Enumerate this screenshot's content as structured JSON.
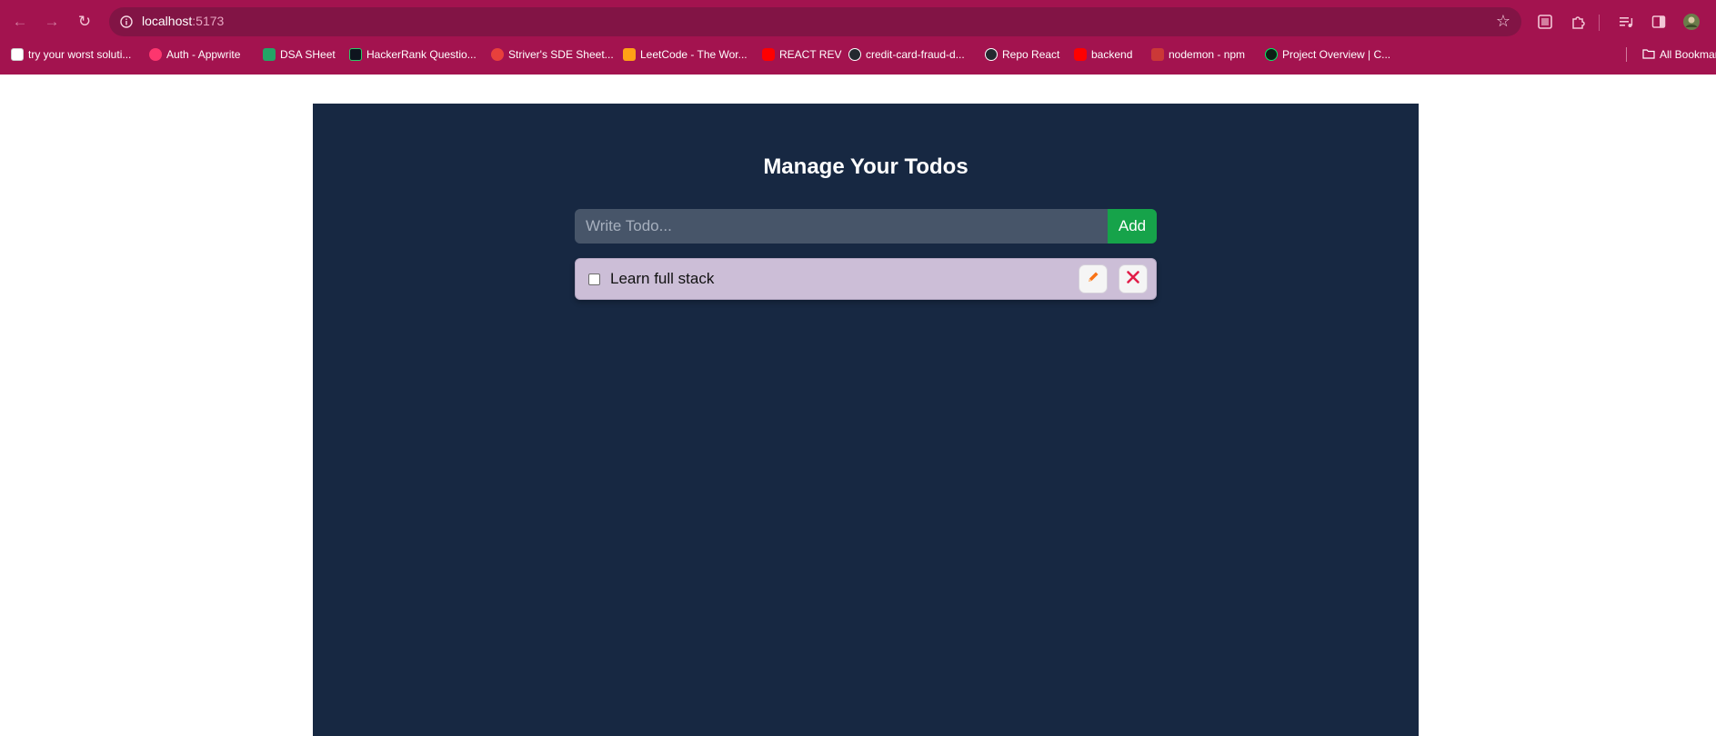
{
  "browser": {
    "url_host": "localhost",
    "url_port": ":5173",
    "bookmarks": [
      {
        "label": "try your worst soluti...",
        "color": "#ffffff"
      },
      {
        "label": "Auth - Appwrite",
        "color": "#fd366e"
      },
      {
        "label": "DSA SHeet",
        "color": "#23a566"
      },
      {
        "label": "HackerRank Questio...",
        "color": "#0e141e"
      },
      {
        "label": "Striver's SDE Sheet...",
        "color": "#e8403c"
      },
      {
        "label": "LeetCode - The Wor...",
        "color": "#ffa116"
      },
      {
        "label": "REACT REV",
        "color": "#ff0000"
      },
      {
        "label": "credit-card-fraud-d...",
        "color": "#24292f"
      },
      {
        "label": "Repo React",
        "color": "#24292f"
      },
      {
        "label": "backend",
        "color": "#ff0000"
      },
      {
        "label": "nodemon - npm",
        "color": "#cb3837"
      },
      {
        "label": "Project Overview | C...",
        "color": "#0b1f14"
      }
    ],
    "all_bookmarks_label": "All Bookmarks"
  },
  "app": {
    "title": "Manage Your Todos",
    "input_placeholder": "Write Todo...",
    "add_label": "Add",
    "todos": [
      {
        "text": "Learn full stack",
        "completed": false
      }
    ]
  },
  "colors": {
    "chrome_bg": "#a3134f",
    "page_bg": "#172842",
    "input_bg": "#475569",
    "add_button": "#16a34a",
    "todo_item_bg": "#ccbed7",
    "edit_icon": "#f97316",
    "delete_icon": "#e11d48"
  }
}
